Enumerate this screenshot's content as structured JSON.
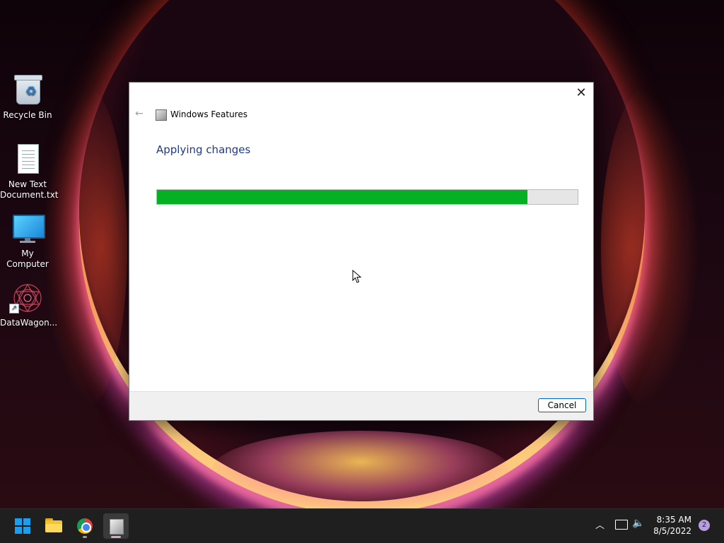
{
  "desktop": {
    "icons": [
      {
        "label": "Recycle Bin"
      },
      {
        "label": "New Text Document.txt"
      },
      {
        "label": "My Computer"
      },
      {
        "label": "DataWagon..."
      }
    ]
  },
  "dialog": {
    "title": "Windows Features",
    "heading": "Applying changes",
    "progress_percent": 88,
    "cancel_label": "Cancel",
    "close_icon": "close-icon",
    "back_icon": "back-arrow-icon"
  },
  "taskbar": {
    "apps": [
      {
        "name": "start",
        "icon": "windows-logo-icon"
      },
      {
        "name": "file-explorer",
        "icon": "folder-icon"
      },
      {
        "name": "chrome",
        "icon": "chrome-icon"
      },
      {
        "name": "windows-features",
        "icon": "windows-features-icon",
        "active": true
      }
    ],
    "tray": {
      "time": "8:35 AM",
      "date": "8/5/2022",
      "notification_count": "2"
    }
  },
  "colors": {
    "progress_fill": "#06b025",
    "heading": "#1e3a8a",
    "button_border": "#0067c0"
  }
}
